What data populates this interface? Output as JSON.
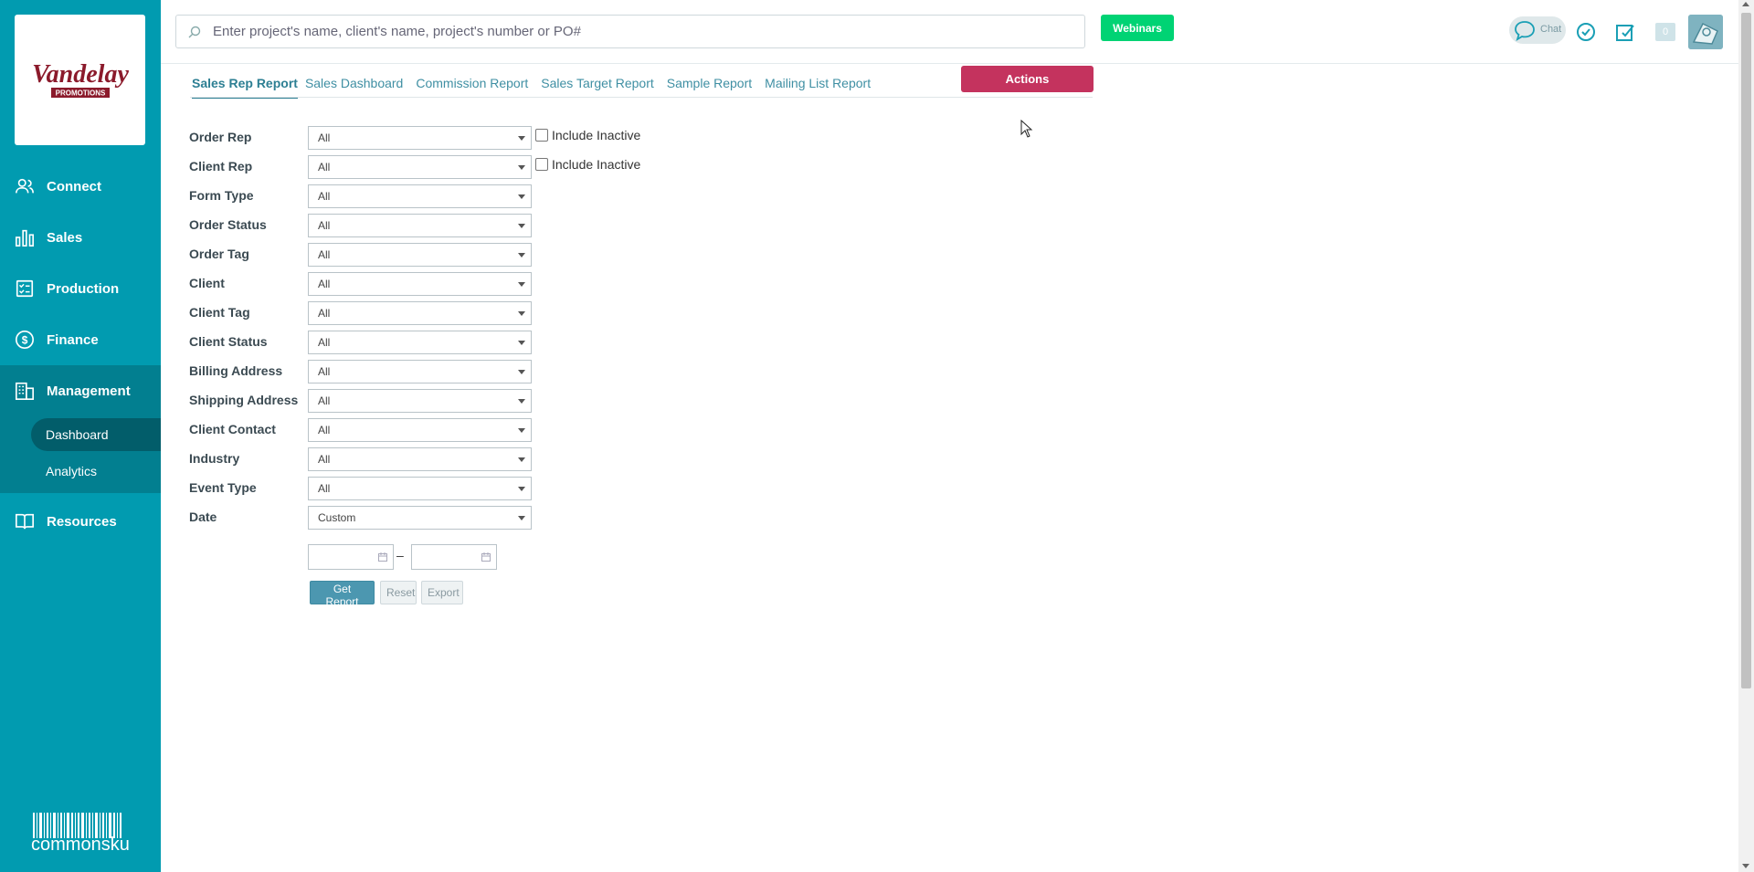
{
  "brand": {
    "logo_line1": "Vandelay",
    "logo_line2": "PROMOTIONS",
    "footer": "commonsku"
  },
  "sidebar": {
    "items": [
      {
        "label": "Connect",
        "icon": "users-icon"
      },
      {
        "label": "Sales",
        "icon": "bar-chart-icon"
      },
      {
        "label": "Production",
        "icon": "clipboard-icon"
      },
      {
        "label": "Finance",
        "icon": "dollar-icon"
      },
      {
        "label": "Management",
        "icon": "building-icon"
      },
      {
        "label": "Resources",
        "icon": "book-icon"
      }
    ],
    "management_sub": [
      "Dashboard",
      "Analytics"
    ]
  },
  "header": {
    "search_placeholder": "Enter project's name, client's name, project's number or PO#",
    "webinars_label": "Webinars",
    "chat_label": "Chat",
    "notification_count": "0"
  },
  "tabs": [
    "Sales Rep Report",
    "Sales Dashboard",
    "Commission Report",
    "Sales Target Report",
    "Sample Report",
    "Mailing List Report"
  ],
  "actions_label": "Actions",
  "form": {
    "fields": [
      {
        "label": "Order Rep",
        "value": "All"
      },
      {
        "label": "Client Rep",
        "value": "All"
      },
      {
        "label": "Form Type",
        "value": "All"
      },
      {
        "label": "Order Status",
        "value": "All"
      },
      {
        "label": "Order Tag",
        "value": "All"
      },
      {
        "label": "Client",
        "value": "All"
      },
      {
        "label": "Client Tag",
        "value": "All"
      },
      {
        "label": "Client Status",
        "value": "All"
      },
      {
        "label": "Billing Address",
        "value": "All"
      },
      {
        "label": "Shipping Address",
        "value": "All"
      },
      {
        "label": "Client Contact",
        "value": "All"
      },
      {
        "label": "Industry",
        "value": "All"
      },
      {
        "label": "Event Type",
        "value": "All"
      },
      {
        "label": "Date",
        "value": "Custom"
      }
    ],
    "include_inactive_label": "Include Inactive",
    "date_separator": "–",
    "buttons": {
      "get_report": "Get Report",
      "reset": "Reset",
      "export": "Export"
    }
  }
}
